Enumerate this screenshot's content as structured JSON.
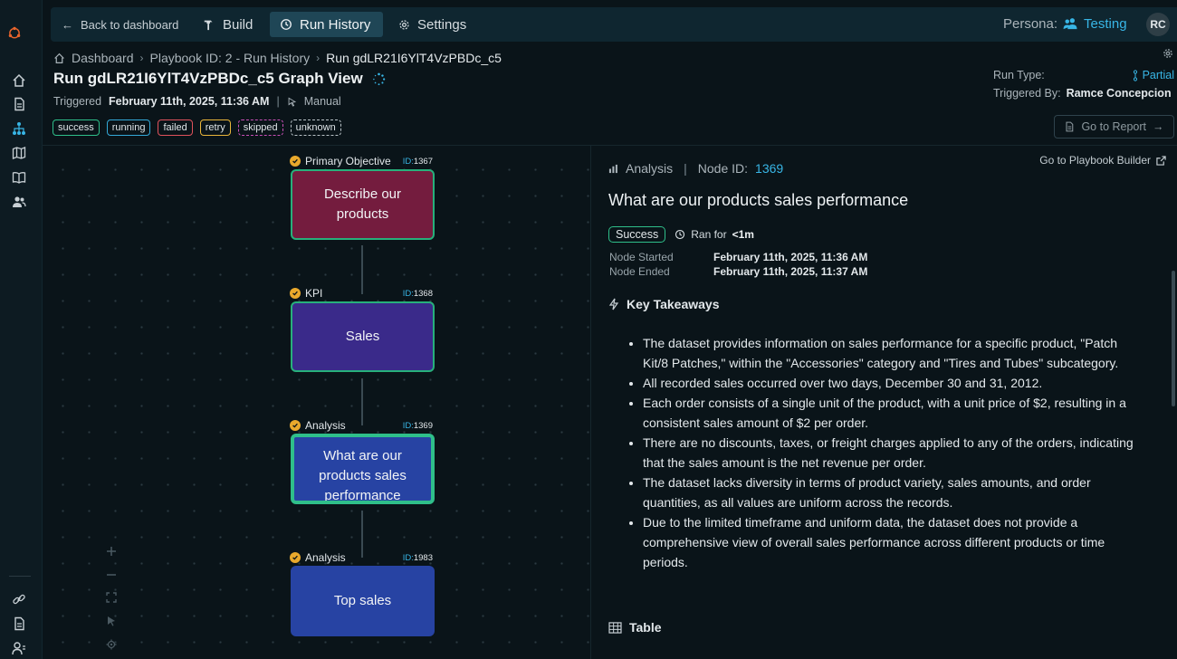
{
  "nav": {
    "back_label": "Back to dashboard",
    "build_label": "Build",
    "run_history_label": "Run History",
    "settings_label": "Settings",
    "persona_label": "Persona:",
    "persona_value": "Testing",
    "avatar_initials": "RC"
  },
  "breadcrumb": {
    "items": [
      "Dashboard",
      "Playbook ID: 2 - Run History",
      "Run gdLR21I6YlT4VzPBDc_c5"
    ]
  },
  "run": {
    "title": "Run gdLR21I6YlT4VzPBDc_c5 Graph View",
    "triggered_label": "Triggered",
    "triggered_date": "February 11th, 2025, 11:36 AM",
    "trigger_mode": "Manual",
    "run_type_label": "Run Type:",
    "run_type_value": "Partial",
    "triggered_by_label": "Triggered By:",
    "triggered_by_value": "Ramce Concepcion",
    "report_button": "Go to Report"
  },
  "legend": [
    "success",
    "running",
    "failed",
    "retry",
    "skipped",
    "unknown"
  ],
  "graph": {
    "nodes": [
      {
        "type": "Primary Objective",
        "id_label": "ID:",
        "id": "1367",
        "text": "Describe our products"
      },
      {
        "type": "KPI",
        "id_label": "ID:",
        "id": "1368",
        "text": "Sales"
      },
      {
        "type": "Analysis",
        "id_label": "ID:",
        "id": "1369",
        "text": "What are our products sales performance"
      },
      {
        "type": "Analysis",
        "id_label": "ID:",
        "id": "1983",
        "text": "Top sales"
      }
    ]
  },
  "detail": {
    "type_label": "Analysis",
    "node_id_label": "Node ID:",
    "node_id": "1369",
    "builder_link": "Go to Playbook Builder",
    "title": "What are our products sales performance",
    "status": "Success",
    "ran_for_label": "Ran for",
    "ran_for_value": "<1m",
    "started_label": "Node Started",
    "started_value": "February 11th, 2025, 11:36 AM",
    "ended_label": "Node Ended",
    "ended_value": "February 11th, 2025, 11:37 AM",
    "takeaways_heading": "Key Takeaways",
    "takeaways": [
      "The dataset provides information on sales performance for a specific product, \"Patch Kit/8 Patches,\" within the \"Accessories\" category and \"Tires and Tubes\" subcategory.",
      "All recorded sales occurred over two days, December 30 and 31, 2012.",
      "Each order consists of a single unit of the product, with a unit price of $2, resulting in a consistent sales amount of $2 per order.",
      "There are no discounts, taxes, or freight charges applied to any of the orders, indicating that the sales amount is the net revenue per order.",
      "The dataset lacks diversity in terms of product variety, sales amounts, and order quantities, as all values are uniform across the records.",
      "Due to the limited timeframe and uniform data, the dataset does not provide a comprehensive view of overall sales performance across different products or time periods."
    ],
    "table_heading": "Table"
  },
  "colors": {
    "accent": "#38b6e6",
    "success": "#2fbf8a",
    "primary_node": "#741c3e",
    "kpi_node": "#3a2a8a",
    "analysis_node": "#2743a3"
  }
}
